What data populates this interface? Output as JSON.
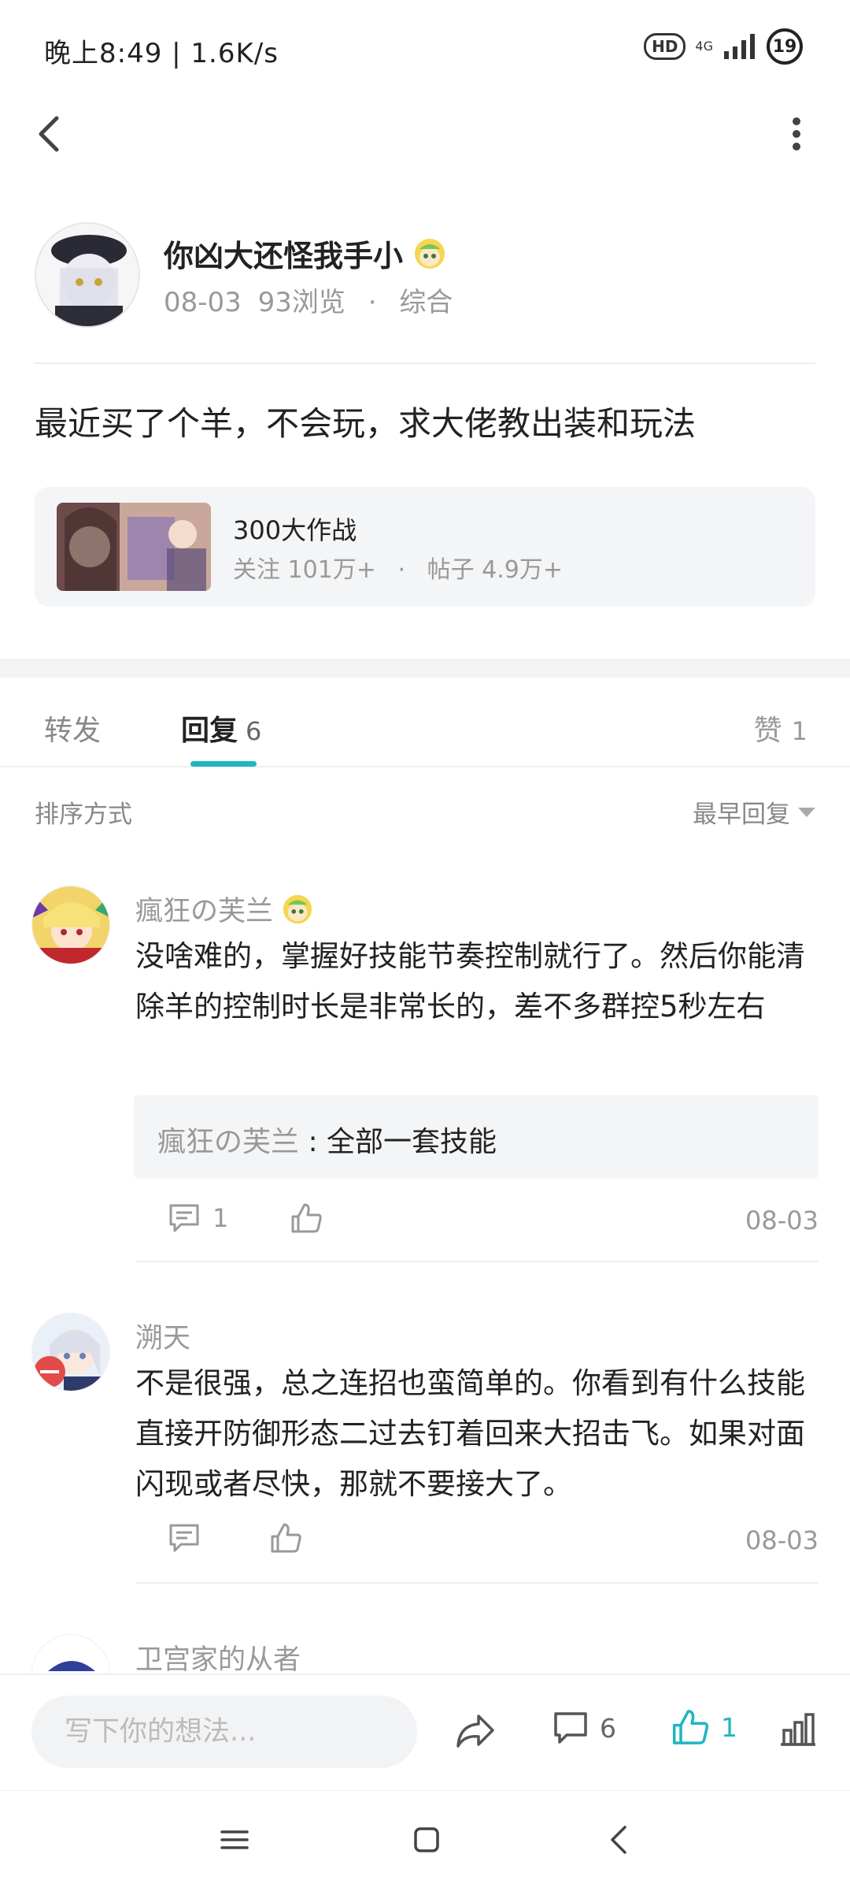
{
  "status_bar": {
    "time": "晚上8:49 | 1.6K/s",
    "hd": "HD",
    "network": "4G",
    "battery": "19"
  },
  "icons": {
    "back": "chevron-left-icon",
    "more": "more-vertical-icon",
    "share": "share-arrow-icon",
    "comment": "comment-bubble-icon",
    "like": "thumbs-up-icon",
    "stats": "bar-chart-icon",
    "menu": "menu-lines-icon",
    "home": "square-home-icon",
    "nav_back": "triangle-back-icon"
  },
  "colors": {
    "accent": "#1fb6c1",
    "muted": "#999999",
    "card_bg": "#f4f5f7"
  },
  "post": {
    "author": "你凶大还怪我手小",
    "date": "08-03",
    "views": "93浏览",
    "separator": "·",
    "category": "综合",
    "title": "最近买了个羊，不会玩，求大佬教出装和玩法"
  },
  "game_card": {
    "name": "300大作战",
    "followers": "关注 101万+",
    "separator": "·",
    "posts": "帖子 4.9万+"
  },
  "tabs": {
    "forward": "转发",
    "reply": "回复",
    "reply_count": "6",
    "like": "赞",
    "like_count": "1"
  },
  "sort": {
    "label": "排序方式",
    "value": "最早回复"
  },
  "comments": [
    {
      "name": "瘋狂の芙兰",
      "text": "没啥难的，掌握好技能节奏控制就行了。然后你能清除羊的控制时长是非常长的，差不多群控5秒左右",
      "quote_user": "瘋狂の芙兰",
      "quote_sep": " : ",
      "quote_text": "全部一套技能",
      "reply_count": "1",
      "date": "08-03"
    },
    {
      "name": "溯天",
      "text": "不是很强，总之连招也蛮简单的。你看到有什么技能直接开防御形态二过去钉着回来大招击飞。如果对面闪现或者尽快，那就不要接大了。",
      "date": "08-03"
    },
    {
      "name": "卫宫家的从者"
    }
  ],
  "bottom_bar": {
    "placeholder": "写下你的想法...",
    "comment_count": "6",
    "like_count": "1"
  }
}
